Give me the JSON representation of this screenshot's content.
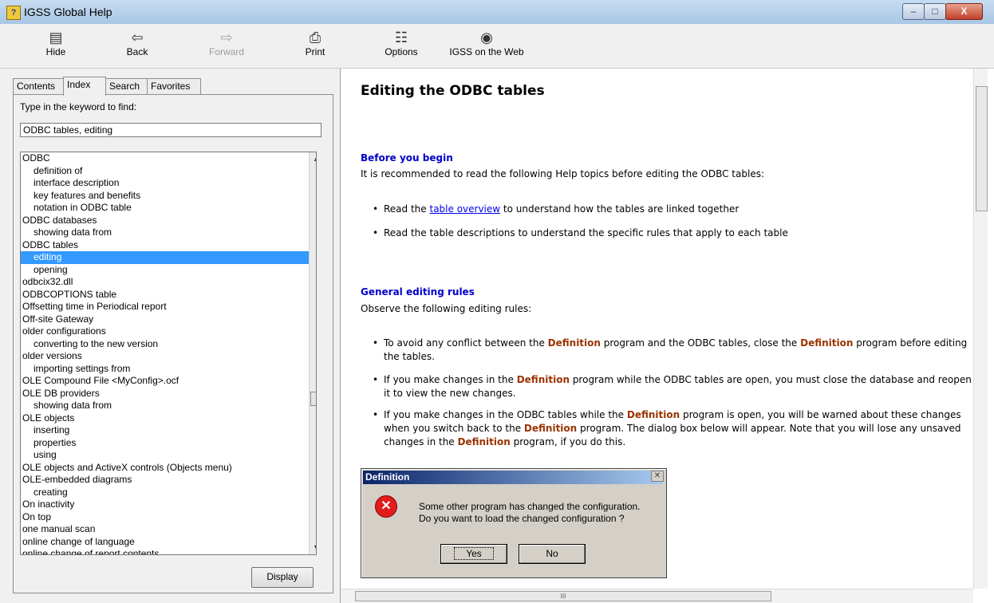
{
  "window": {
    "title": "IGSS Global Help",
    "min_label": "–",
    "max_label": "□",
    "close_label": "X"
  },
  "toolbar": {
    "hide": "Hide",
    "back": "Back",
    "forward": "Forward",
    "print": "Print",
    "options": "Options",
    "web": "IGSS on the Web",
    "icons": {
      "hide": "hide-pane-icon",
      "back": "back-arrow-icon",
      "forward": "forward-arrow-icon",
      "print": "printer-icon",
      "options": "options-icon",
      "web": "web-icon"
    }
  },
  "tabs": {
    "contents": "Contents",
    "index": "Index",
    "search": "Search",
    "favorites": "Favorites"
  },
  "index": {
    "keyword_label": "Type in the keyword to find:",
    "keyword_value": "ODBC tables, editing",
    "display_button": "Display",
    "items": [
      {
        "text": "ODBC",
        "level": 0
      },
      {
        "text": "definition of",
        "level": 1
      },
      {
        "text": "interface description",
        "level": 1
      },
      {
        "text": "key features and benefits",
        "level": 1
      },
      {
        "text": "notation in ODBC table",
        "level": 1
      },
      {
        "text": "ODBC databases",
        "level": 0
      },
      {
        "text": "showing data from",
        "level": 1
      },
      {
        "text": "ODBC tables",
        "level": 0
      },
      {
        "text": "editing",
        "level": 1,
        "selected": true
      },
      {
        "text": "opening",
        "level": 1
      },
      {
        "text": "odbcix32.dll",
        "level": 0
      },
      {
        "text": "ODBCOPTIONS table",
        "level": 0
      },
      {
        "text": "Offsetting time in Periodical report",
        "level": 0
      },
      {
        "text": "Off-site Gateway",
        "level": 0
      },
      {
        "text": "older configurations",
        "level": 0
      },
      {
        "text": "converting to the new version",
        "level": 1
      },
      {
        "text": "older versions",
        "level": 0
      },
      {
        "text": "importing settings from",
        "level": 1
      },
      {
        "text": "OLE Compound File  <MyConfig>.ocf",
        "level": 0
      },
      {
        "text": "OLE DB providers",
        "level": 0
      },
      {
        "text": "showing data from",
        "level": 1
      },
      {
        "text": "OLE objects",
        "level": 0
      },
      {
        "text": "inserting",
        "level": 1
      },
      {
        "text": "properties",
        "level": 1
      },
      {
        "text": "using",
        "level": 1
      },
      {
        "text": "OLE objects and ActiveX controls (Objects menu)",
        "level": 0
      },
      {
        "text": "OLE-embedded diagrams",
        "level": 0
      },
      {
        "text": "creating",
        "level": 1
      },
      {
        "text": "On inactivity",
        "level": 0
      },
      {
        "text": "On top",
        "level": 0
      },
      {
        "text": "one manual scan",
        "level": 0
      },
      {
        "text": "online change of language",
        "level": 0
      },
      {
        "text": "online change of report contents",
        "level": 0
      }
    ]
  },
  "topic": {
    "title": "Editing the ODBC tables",
    "before_heading": "Before you begin",
    "before_intro": "It is recommended to read the following Help topics before editing the ODBC tables:",
    "before_bullet1_prefix": "Read the ",
    "before_bullet1_link": "table overview",
    "before_bullet1_suffix": " to understand how the tables are linked together",
    "before_bullet2": "Read the table descriptions to understand the specific rules that apply to each table",
    "rules_heading": "General editing rules",
    "rules_intro": "Observe the following editing rules:",
    "def_word": "Definition",
    "rule1_a": "To avoid any conflict between the ",
    "rule1_b": " program and the ODBC tables, close the ",
    "rule1_c": " program before editing the tables.",
    "rule2_a": "If you make changes in the ",
    "rule2_b": " program while the ODBC tables are open, you must close the database and reopen it to view the new changes.",
    "rule3_a": "If you make changes in the ODBC tables while the ",
    "rule3_b": " program is open, you will be warned about these changes when you switch back to the ",
    "rule3_c": " program. The dialog box below will appear. Note that you will lose any unsaved changes in the ",
    "rule3_d": " program, if you do this."
  },
  "dialog": {
    "title": "Definition",
    "line1": "Some other program has changed the configuration.",
    "line2": "Do you want to load the changed configuration ?",
    "yes": "Yes",
    "no": "No",
    "icon": "error-icon"
  },
  "scrollbar": {
    "grip": "III"
  }
}
